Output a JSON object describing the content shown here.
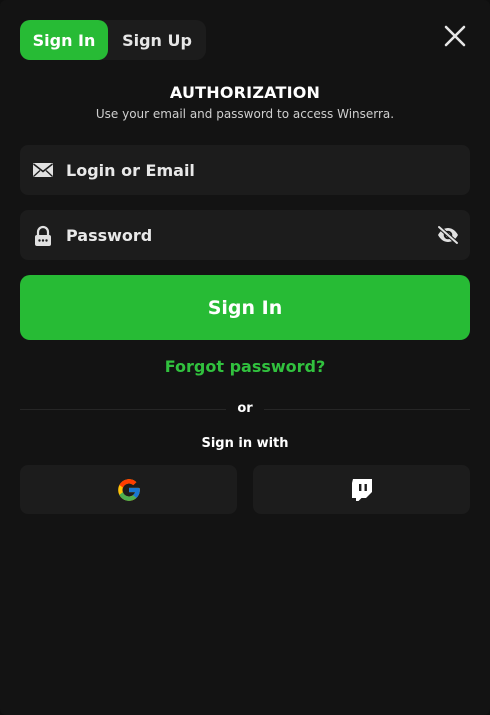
{
  "tabs": [
    {
      "label": "Sign In",
      "active": true
    },
    {
      "label": "Sign Up",
      "active": false
    }
  ],
  "close": {
    "icon": "close-icon"
  },
  "header": {
    "title": "AUTHORIZATION",
    "subtitle": "Use your email and password to access Winserra."
  },
  "form": {
    "login": {
      "placeholder": "Login or Email",
      "value": "",
      "icon": "envelope-icon"
    },
    "password": {
      "placeholder": "Password",
      "value": "",
      "icon": "lock-icon",
      "toggle_icon": "eye-slash-icon"
    },
    "submit_label": "Sign In",
    "forgot_label": "Forgot password?"
  },
  "divider": {
    "label": "or"
  },
  "social": {
    "label": "Sign in with",
    "providers": [
      {
        "name": "Google",
        "icon": "google-icon"
      },
      {
        "name": "Twitch",
        "icon": "twitch-icon"
      }
    ]
  },
  "colors": {
    "accent": "#27bb35",
    "link": "#31c13e",
    "background": "#131313",
    "field": "#1c1c1c"
  }
}
